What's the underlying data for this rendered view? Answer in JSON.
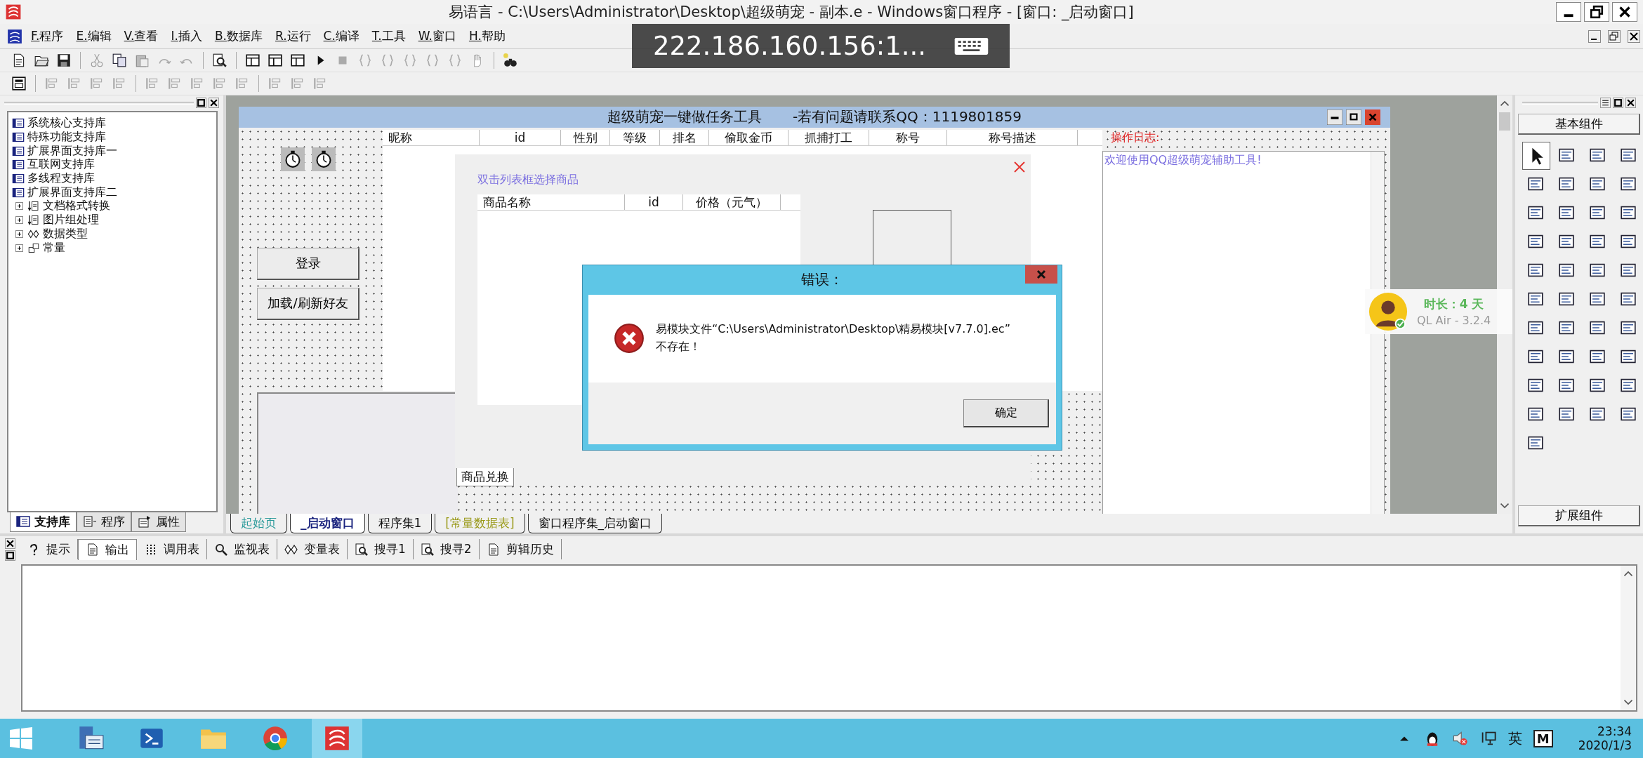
{
  "window": {
    "title": "易语言 - C:\\Users\\Administrator\\Desktop\\超级萌宠 - 副本.e - Windows窗口程序 - [窗口: _启动窗口]"
  },
  "remote_overlay": {
    "address": "222.186.160.156:1..."
  },
  "menu": [
    "F.程序",
    "E.编辑",
    "V.查看",
    "I.插入",
    "B.数据库",
    "R.运行",
    "C.编译",
    "T.工具",
    "W.窗口",
    "H.帮助"
  ],
  "library_panel": {
    "tree": [
      {
        "label": "系统核心支持库",
        "kind": "library"
      },
      {
        "label": "特殊功能支持库",
        "kind": "library"
      },
      {
        "label": "扩展界面支持库一",
        "kind": "library"
      },
      {
        "label": "互联网支持库",
        "kind": "library"
      },
      {
        "label": "多线程支持库",
        "kind": "library"
      },
      {
        "label": "扩展界面支持库二",
        "kind": "library"
      },
      {
        "label": "文档格式转换",
        "kind": "module",
        "expanded": false
      },
      {
        "label": "图片组处理",
        "kind": "module",
        "expanded": false
      },
      {
        "label": "数据类型",
        "kind": "datatype",
        "expanded": false
      },
      {
        "label": "常量",
        "kind": "constant",
        "expanded": false
      }
    ],
    "tabs": [
      {
        "label": "支持库",
        "kind": "library",
        "selected": true
      },
      {
        "label": "程序",
        "kind": "program",
        "selected": false
      },
      {
        "label": "属性",
        "kind": "property",
        "selected": false
      }
    ]
  },
  "form": {
    "title": "超级萌宠一键做任务工具",
    "subtitle": "-若有问题请联系QQ：1119801859",
    "buttons": [
      "登录",
      "加载/刷新好友"
    ],
    "friend_columns": [
      "昵称",
      "id",
      "性别",
      "等级",
      "排名",
      "偷取金币",
      "抓捕打工",
      "称号",
      "称号描述"
    ],
    "log_label": "操作日志:",
    "log_text": "欢迎使用QQ超级萌宠辅助工具!",
    "shop": {
      "hint": "双击列表框选择商品",
      "columns": [
        "商品名称",
        "id",
        "价格（元气）"
      ],
      "tab": "商品兑换"
    }
  },
  "error_dialog": {
    "title": "错误：",
    "lines": [
      "易模块文件“C:\\Users\\Administrator\\Desktop\\精易模块[v7.7.0].ec”",
      "不存在！"
    ],
    "button": "确定"
  },
  "doc_tabs": [
    {
      "label": "起始页",
      "selected": false,
      "color": "#2a9a9a"
    },
    {
      "label": "_启动窗口",
      "selected": true,
      "color": "#1a237e"
    },
    {
      "label": "程序集1",
      "selected": false,
      "color": "#111111"
    },
    {
      "label": "[常量数据表]",
      "selected": false,
      "color": "#9a9a1a"
    },
    {
      "label": "窗口程序集_启动窗口",
      "selected": false,
      "color": "#111111"
    }
  ],
  "qq_widget": {
    "duration": "时长：4 天",
    "version": "QL Air - 3.2.4"
  },
  "toolbox": {
    "header": "基本组件",
    "footer": "扩展组件"
  },
  "output_panel": {
    "tabs": [
      {
        "label": "提示",
        "kind": "question",
        "selected": false
      },
      {
        "label": "输出",
        "kind": "document",
        "selected": true
      },
      {
        "label": "调用表",
        "kind": "dots",
        "selected": false
      },
      {
        "label": "监视表",
        "kind": "lens",
        "selected": false
      },
      {
        "label": "变量表",
        "kind": "datatype",
        "selected": false
      },
      {
        "label": "搜寻1",
        "kind": "magnifier",
        "selected": false
      },
      {
        "label": "搜寻2",
        "kind": "magnifier",
        "selected": false
      },
      {
        "label": "剪辑历史",
        "kind": "document",
        "selected": false
      }
    ]
  },
  "taskbar": {
    "apps": [
      {
        "kind": "server",
        "selected": false
      },
      {
        "kind": "shell",
        "selected": false
      },
      {
        "kind": "folder",
        "selected": false
      },
      {
        "kind": "browser",
        "selected": false
      },
      {
        "kind": "ide",
        "selected": true
      }
    ],
    "tray": {
      "ime": "英",
      "badge": "M",
      "time": "23:34",
      "date": "2020/1/3"
    }
  }
}
